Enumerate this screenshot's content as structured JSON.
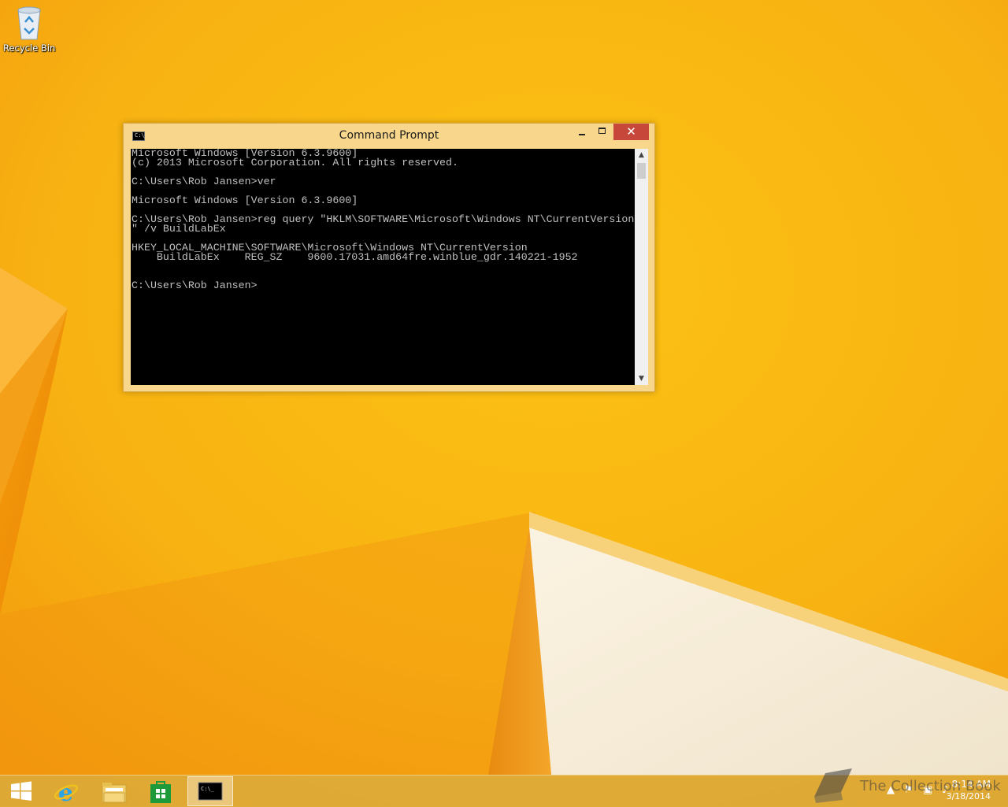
{
  "desktop": {
    "icons": [
      {
        "label": "Recycle Bin",
        "icon": "recycle-bin-icon"
      }
    ]
  },
  "window": {
    "title": "Command Prompt",
    "icon": "console-icon",
    "icon_text": "C:\\",
    "controls": {
      "minimize": "minimize-icon",
      "maximize": "maximize-icon",
      "close": "✕"
    },
    "console_text": "Microsoft Windows [Version 6.3.9600]\n(c) 2013 Microsoft Corporation. All rights reserved.\n\nC:\\Users\\Rob Jansen>ver\n\nMicrosoft Windows [Version 6.3.9600]\n\nC:\\Users\\Rob Jansen>reg query \"HKLM\\SOFTWARE\\Microsoft\\Windows NT\\CurrentVersion\n\" /v BuildLabEx\n\nHKEY_LOCAL_MACHINE\\SOFTWARE\\Microsoft\\Windows NT\\CurrentVersion\n    BuildLabEx    REG_SZ    9600.17031.amd64fre.winblue_gdr.140221-1952\n\n\nC:\\Users\\Rob Jansen>"
  },
  "taskbar": {
    "items": [
      {
        "name": "start",
        "icon": "windows-logo-icon"
      },
      {
        "name": "internet-explorer",
        "icon": "internet-explorer-icon"
      },
      {
        "name": "file-explorer",
        "icon": "file-explorer-icon"
      },
      {
        "name": "store",
        "icon": "windows-store-icon"
      },
      {
        "name": "command-prompt",
        "icon": "command-prompt-icon",
        "active": true,
        "icon_text": "C:\\_"
      }
    ],
    "tray": {
      "time": "8:14 AM",
      "date": "3/18/2014"
    }
  },
  "watermark": {
    "text": "The Collection Book",
    "icon": "book-icon"
  },
  "colors": {
    "accent": "#f8d78c",
    "close": "#c7473a",
    "wallpaper": "#f7ae12"
  }
}
